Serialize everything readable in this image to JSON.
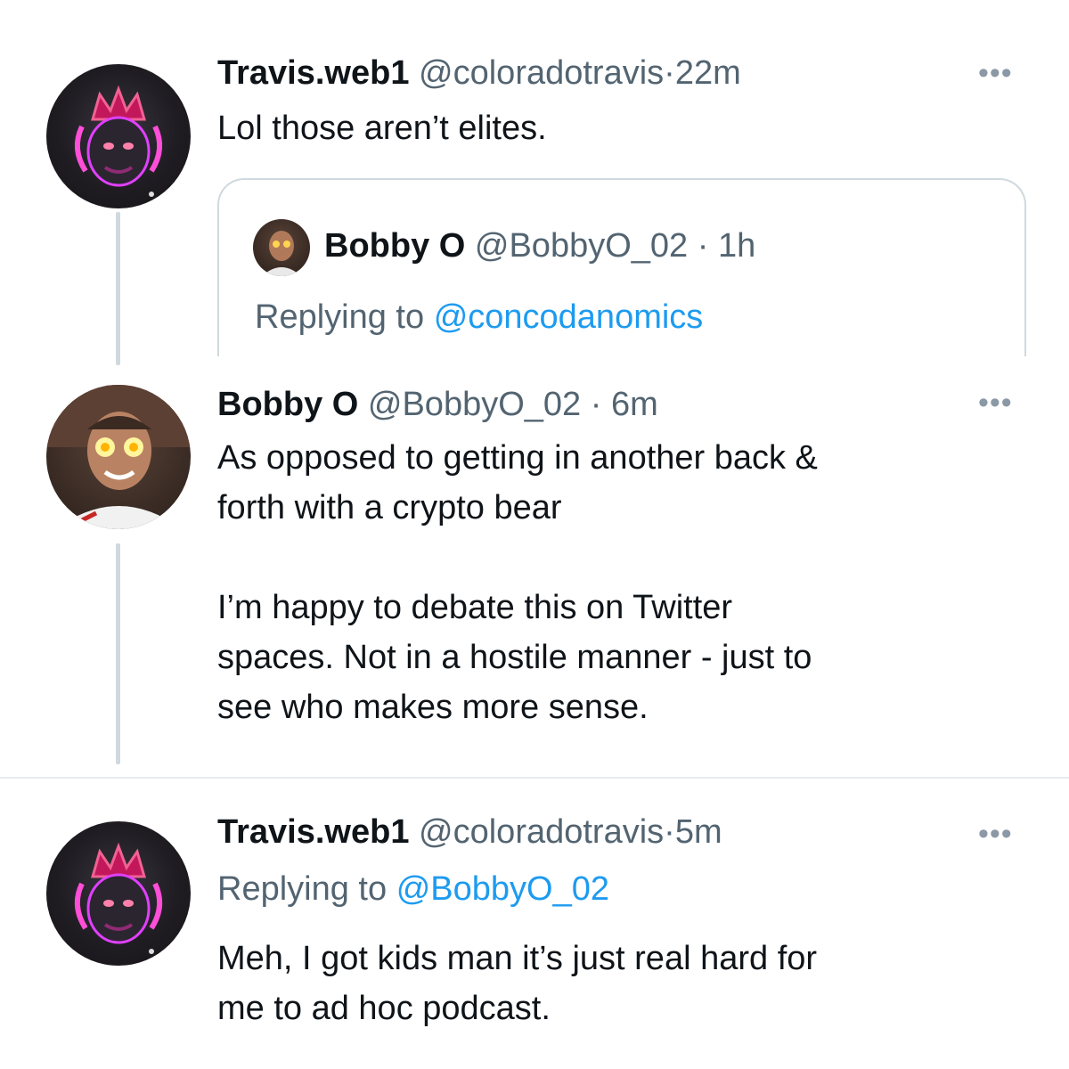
{
  "tweets": [
    {
      "name": "Travis.web1",
      "handle": "@coloradotravis",
      "dot": "·",
      "time": "22m",
      "text": "Lol those aren’t elites.",
      "more": "•••",
      "quote": {
        "name": "Bobby O",
        "handle": "@BobbyO_02",
        "dot": "·",
        "time": "1h",
        "replying_prefix": "Replying to",
        "replying_handle": "@concodanomics"
      }
    },
    {
      "name": "Bobby O",
      "handle": "@BobbyO_02",
      "dot": "·",
      "time": "6m",
      "text": "As opposed to getting in another back &\nforth with a crypto bear\n\nI’m happy to debate this on Twitter\nspaces. Not in a hostile manner - just to\nsee who makes more sense.",
      "more": "•••"
    },
    {
      "name": "Travis.web1",
      "handle": "@coloradotravis",
      "dot": "·",
      "time": "5m",
      "replying_prefix": "Replying to",
      "replying_handle": "@BobbyO_02",
      "text": "Meh, I got kids man it’s just real hard for\nme to ad hoc podcast.",
      "more": "•••"
    }
  ],
  "icons": {
    "travis_avatar": "gorilla-with-crown-avatar",
    "bobby_avatar": "man-with-glowing-eyes-avatar",
    "more": "more-options-icon"
  },
  "colors": {
    "link": "#1d9bf0",
    "muted": "#536471",
    "thread_line": "#cfd9de"
  }
}
